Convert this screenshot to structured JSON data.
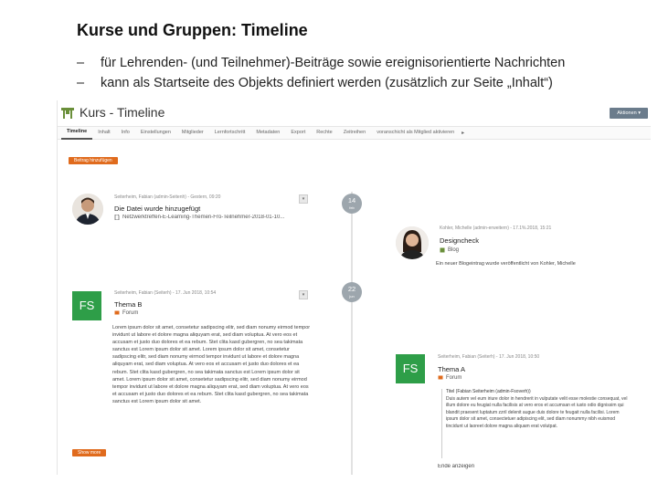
{
  "slide": {
    "title": "Kurse und Gruppen: Timeline",
    "bullets": [
      {
        "dash": "–",
        "text": "für Lehrenden- (und Teilnehmer)-Beiträge sowie ereignisorientierte Nachrichten"
      },
      {
        "dash": "–",
        "text": "kann als Startseite des Objekts definiert werden (zusätzlich zur Seite „Inhalt“)"
      }
    ]
  },
  "screenshot": {
    "window_title": "Kurs - Timeline",
    "actions_label": "Aktionen ▾",
    "tabs": [
      {
        "label": "Timeline",
        "active": true
      },
      {
        "label": "Inhalt"
      },
      {
        "label": "Info"
      },
      {
        "label": "Einstellungen"
      },
      {
        "label": "Mitglieder"
      },
      {
        "label": "Lernfortschritt"
      },
      {
        "label": "Metadaten"
      },
      {
        "label": "Export"
      },
      {
        "label": "Rechte"
      },
      {
        "label": "Zeitreihen"
      },
      {
        "label": "voranschicht als Mitglied aktivieren"
      }
    ],
    "tab_more": "▸",
    "add_post_label": "Beitrag hinzufügen",
    "show_more_label": "Show more",
    "timeline": {
      "dates": [
        {
          "day": "14",
          "month": "feb"
        },
        {
          "day": "22",
          "month": "jun"
        }
      ]
    },
    "entries": [
      {
        "meta": "Seiterheim, Fabian (admin-Seitenh) - Gestern, 09:20",
        "title": "Die Datei wurde hinzugefügt",
        "sub": "Netzwerktreffen-E-Learning-Themen-Fro-Teilnehmer-2018-01-10...",
        "icon": "file-icon",
        "action_label": "▾"
      },
      {
        "meta": "Kohler, Michelle (admin-erweitern) - 17.1%.2018, 15:21",
        "title": "Designcheck",
        "sub": "Blog",
        "icon": "blog-icon",
        "text": "Ein neuer Blogeintrag wurde veröffentlicht von Kohler, Michelle"
      },
      {
        "meta": "Seiterheim, Fabian (Seiterh) - 17. Jun 2018, 10:54",
        "badge": "FS",
        "title": "Thema B",
        "sub": "Forum",
        "icon": "forum-icon",
        "action_label": "▾",
        "text": "Lorem ipsum dolor sit amet, consetetur sadipscing elitr, sed diam nonumy eirmod tempor invidunt ut labore et dolore magna aliquyam erat, sed diam voluptua. At vero eos et accusam et justo duo dolores et ea rebum. Stet clita kasd gubergren, no sea takimata sanctus est Lorem ipsum dolor sit amet. Lorem ipsum dolor sit amet, consetetur sadipscing elitr, sed diam nonumy eirmod tempor invidunt ut labore et dolore magna aliquyam erat, sed diam voluptua. At vero eos et accusam et justo duo dolores et ea rebum. Stet clita kasd gubergren, no sea takimata sanctus est Lorem ipsum dolor sit amet. Lorem ipsum dolor sit amet, consetetur sadipscing elitr, sed diam nonumy eirmod tempor invidunt ut labore et dolore magna aliquyam erat, sed diam voluptua. At vero eos et accusam et justo duo dolores et ea rebum. Stet clita kasd gubergren, no sea takimata sanctus est Lorem ipsum dolor sit amet."
      },
      {
        "meta": "Seiterheim, Fabian (Seiterh) - 17. Jun 2018, 10:50",
        "badge": "FS",
        "title": "Thema A",
        "sub": "Forum",
        "icon": "forum-icon",
        "post_author": "Titel (Fabian Seiterheim (admin-Fsoverh))",
        "text": "Duis autem vel eum iriure dolor in hendrerit in vulputate velit esse molestie consequat, vel illum dolore eu feugiat nulla facilisis at vero eros et accumsan et iusto odio dignissim qui blandit praesent luptatum zzril delenit augue duis dolore te feugait nulla facilisi. Lorem ipsum dolor sit amet, consectetuer adipiscing elit, sed diam nonummy nibh euismod tincidunt ut laoreet dolore magna aliquam erat volutpat.",
        "footer": "Ende anzeigen"
      }
    ],
    "colors": {
      "accent_orange": "#e06b1d",
      "badge_green": "#2e9e48",
      "logo_green": "#6a8f3a",
      "date_bubble": "#9da6ad"
    }
  }
}
